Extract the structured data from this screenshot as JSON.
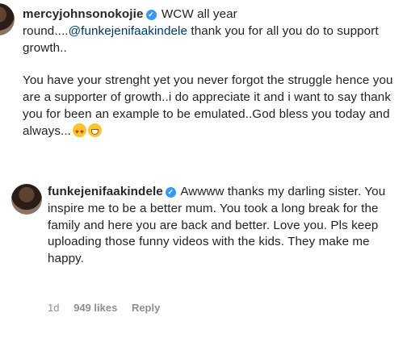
{
  "comment": {
    "username": "mercyjohnsonokojie",
    "text_line1": " WCW all year round....",
    "mention": "@funkejenifaakindele",
    "text_line1_end": " thank you for all you do to support growth..",
    "paragraph2": "You have your strenght yet you never forgot the struggle hence you are a supporter of growth..i do appreciate it and i want to say thank you for been an example to be emulated..God bless you today and always...",
    "emoji1": "smiling-face-with-heart-eyes",
    "emoji2": "grinning-face-with-sweat"
  },
  "reply": {
    "username": "funkejenifaakindele",
    "text": " Awwww thanks my darling sister. You inspire me to be a better mum. You took a long break for the family and  here you are back and better. Love you. Pls keep uploading those funny videos with the kids. They make me happy.",
    "time": "1d",
    "likes": "949 likes",
    "reply_label": "Reply"
  },
  "colors": {
    "verified": "#3897f0",
    "mention": "#00376b",
    "meta": "#8e8e8e"
  }
}
